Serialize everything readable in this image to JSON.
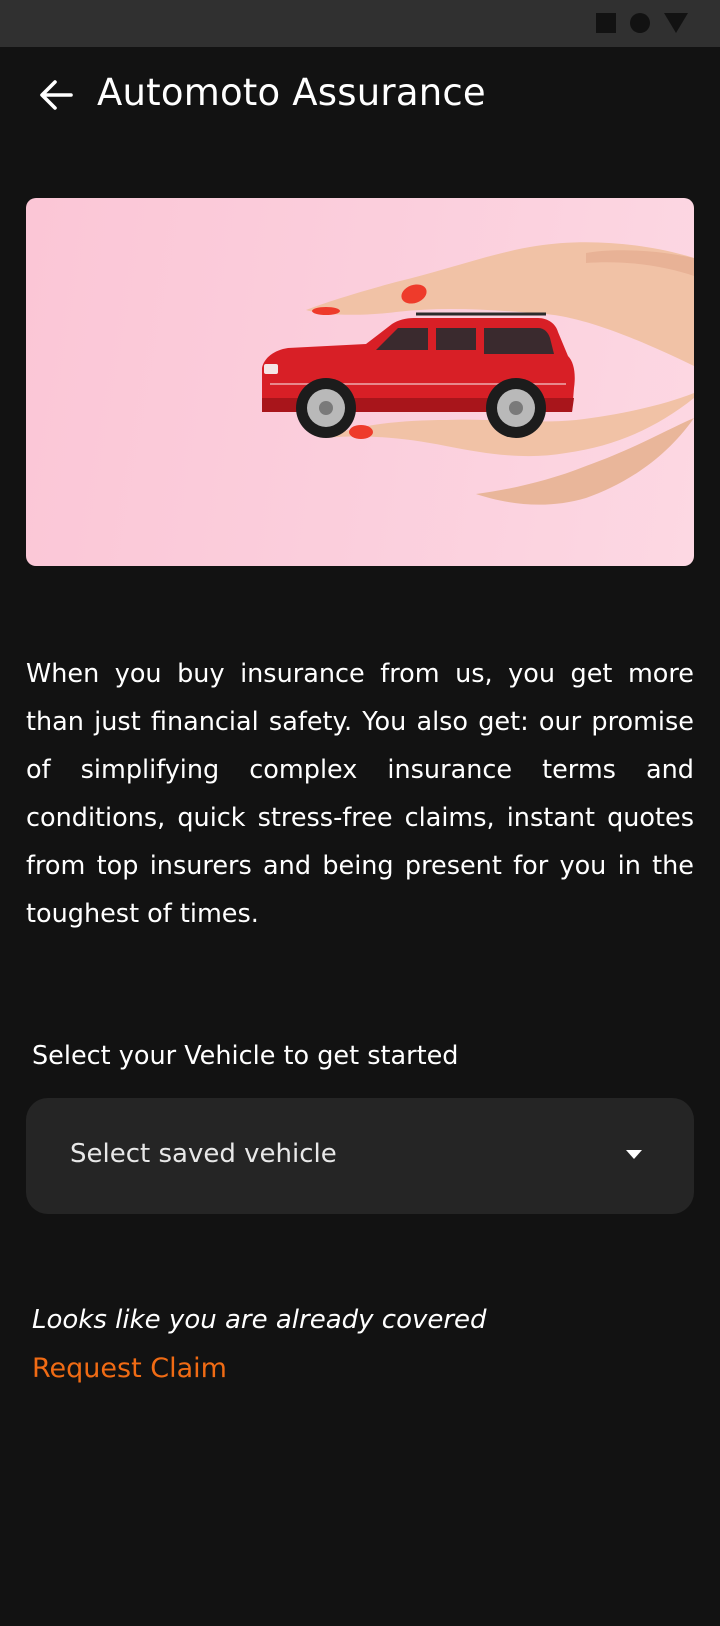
{
  "header": {
    "title": "Automoto Assurance",
    "back_icon": "arrow-left-icon"
  },
  "status_bar": {
    "icons": [
      "square-icon",
      "circle-icon",
      "triangle-icon"
    ]
  },
  "hero": {
    "image": "hands-protecting-red-car",
    "background_color": "#fbcbd9"
  },
  "description": "When you buy insurance from us, you get more than just financial safety. You also get: our promise of simplifying complex insurance terms and conditions, quick stress-free claims, instant quotes from top insurers and being present for you in the toughest of times.",
  "vehicle_select": {
    "label": "Select your Vehicle to get started",
    "placeholder": "Select saved vehicle",
    "icon": "dropdown-caret-icon"
  },
  "coverage": {
    "message": "Looks like you are already covered",
    "action_label": "Request Claim"
  },
  "colors": {
    "background": "#121212",
    "status_bar": "#303030",
    "select_background": "#252525",
    "accent": "#f06b14"
  }
}
